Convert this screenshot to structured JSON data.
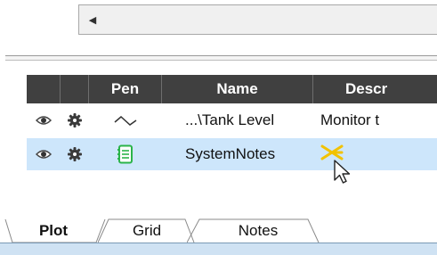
{
  "scrollbar": {
    "left_arrow_icon": "triangle-left"
  },
  "grid": {
    "headers": {
      "eye": "",
      "gear": "",
      "pen": "Pen",
      "name": "Name",
      "description": "Descr"
    },
    "rows": [
      {
        "name": "...\\Tank Level",
        "description": "Monitor t",
        "pen_icon": "line-trend-icon",
        "selected": false
      },
      {
        "name": "SystemNotes",
        "description": "",
        "pen_icon": "notes-book-icon",
        "selected": true
      }
    ]
  },
  "tabs": [
    {
      "label": "Plot",
      "active": true
    },
    {
      "label": "Grid",
      "active": false
    },
    {
      "label": "Notes",
      "active": false
    }
  ],
  "colors": {
    "header_bg": "#404040",
    "selected_row_bg": "#cde6fb",
    "notes_icon_green": "#2bb44a",
    "cursor_star_yellow": "#f2c200",
    "tab_strip_bg": "#cfe2f3"
  }
}
